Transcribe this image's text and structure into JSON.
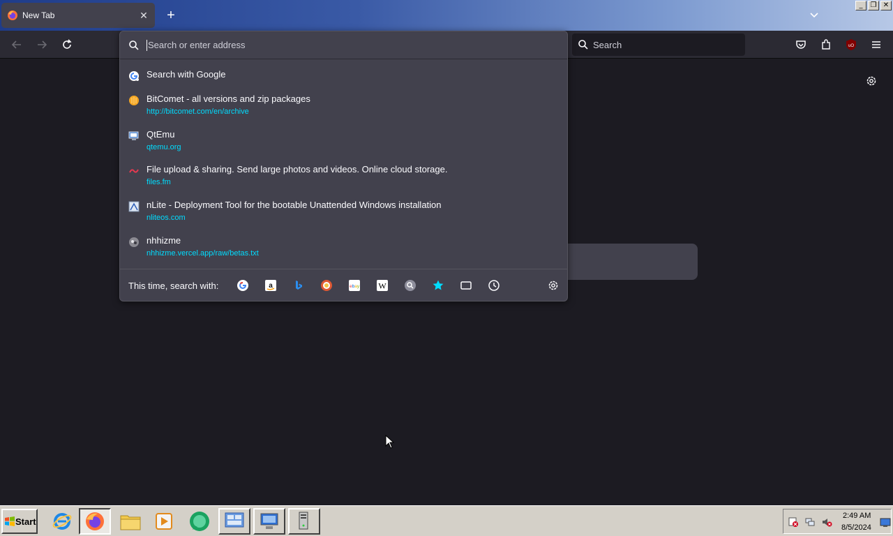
{
  "browser": {
    "tab": {
      "title": "New Tab",
      "favicon": "firefox-icon",
      "close_glyph": "✕"
    },
    "new_tab_glyph": "+",
    "window_controls": [
      "_",
      "❐",
      "✕"
    ],
    "navbar": {
      "search_placeholder": "Search"
    },
    "urlbar": {
      "placeholder": "Search or enter address",
      "results": [
        {
          "title": "Search with Google",
          "url": "",
          "icon": "google-icon"
        },
        {
          "title": "BitComet - all versions and zip packages",
          "url": "http://bitcomet.com/en/archive",
          "icon": "bitcomet-icon"
        },
        {
          "title": "QtEmu",
          "url": "qtemu.org",
          "icon": "qtemu-icon"
        },
        {
          "title": "File upload & sharing. Send large photos and videos. Online cloud storage.",
          "url": "files.fm",
          "icon": "filesfm-icon"
        },
        {
          "title": "nLite - Deployment Tool for the bootable Unattended Windows installation",
          "url": "nliteos.com",
          "icon": "nlite-icon"
        },
        {
          "title": "nhhizme",
          "url": "nhhizme.vercel.app/raw/betas.txt",
          "icon": "nhhizme-icon"
        }
      ],
      "one_off_label": "This time, search with:",
      "engines": [
        "google-icon",
        "amazon-icon",
        "bing-icon",
        "duckduckgo-icon",
        "ebay-icon",
        "wikipedia-icon",
        "search-engine-icon",
        "bookmarks-icon",
        "tabs-icon",
        "history-icon"
      ]
    }
  },
  "taskbar": {
    "start_label": "Start",
    "clock_time": "2:49 AM",
    "clock_date": "8/5/2024"
  },
  "colors": {
    "accent_link": "#00ddff",
    "panel": "#42414d",
    "toolbar": "#2b2a33",
    "background": "#1c1b22"
  }
}
